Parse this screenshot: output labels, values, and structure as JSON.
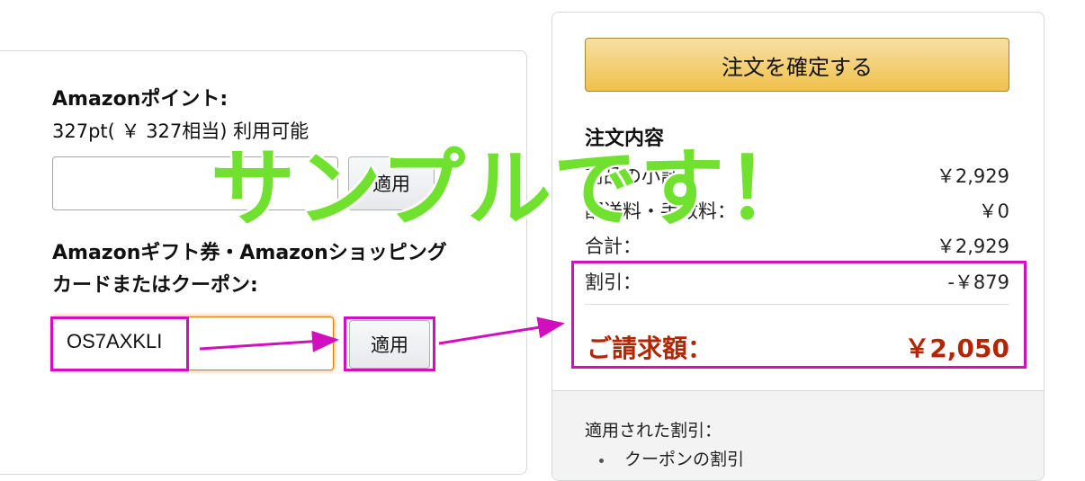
{
  "points": {
    "heading": "Amazonポイント:",
    "available": "327pt( ￥ 327相当) 利用可能",
    "apply_label": "適用"
  },
  "gift": {
    "heading_line1": "Amazonギフト券・Amazonショッピング",
    "heading_line2": "カードまたはクーポン:",
    "coupon_code": "OS7AXKLI",
    "apply_label": "適用"
  },
  "order": {
    "place_order_label": "注文を確定する",
    "summary_title": "注文内容",
    "rows": [
      {
        "label": "商品の小計：",
        "value": "￥2,929"
      },
      {
        "label": "配送料・手数料：",
        "value": "￥0"
      },
      {
        "label": "合計：",
        "value": "￥2,929"
      },
      {
        "label": "割引：",
        "value": "-￥879"
      }
    ],
    "total_label": "ご請求額：",
    "total_value": "￥2,050",
    "applied_discounts_label": "適用された割引：",
    "applied_item": "クーポンの割引"
  },
  "watermark": "サンプルです！",
  "colors": {
    "highlight": "#d10fbf",
    "watermark": "#6fe12e",
    "total": "#b12704",
    "button": "#f0c14b"
  }
}
